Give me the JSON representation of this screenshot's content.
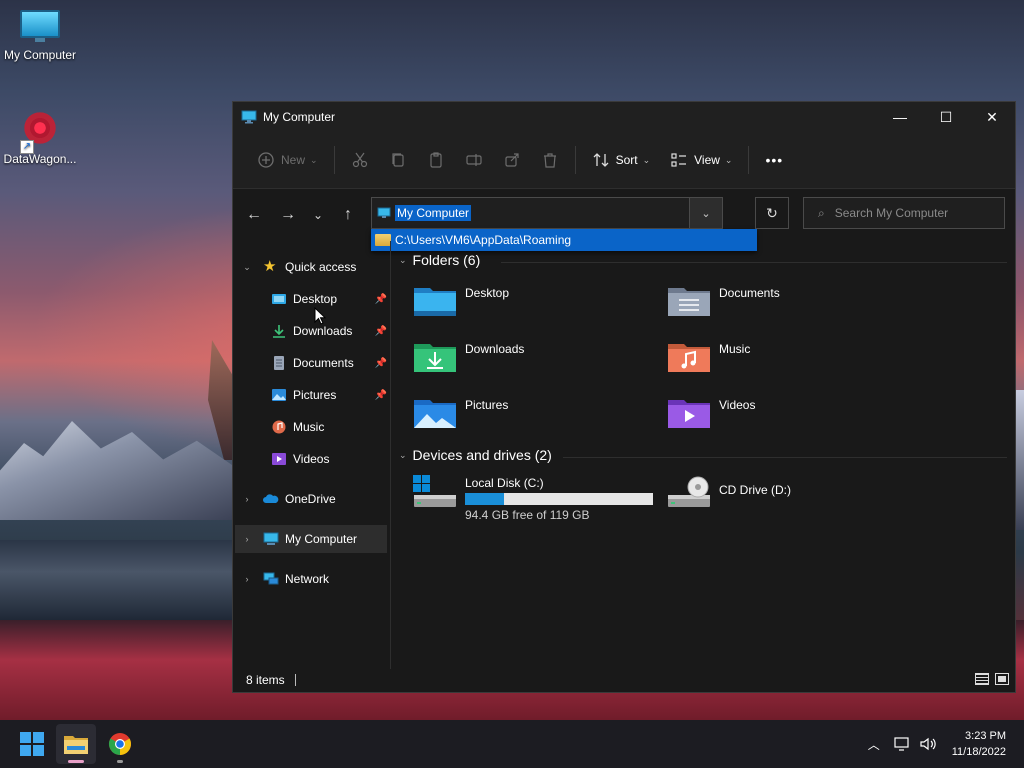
{
  "colors": {
    "accent": "#0a64c8",
    "window_bg": "#191919",
    "taskbar_bg": "#1c1c22"
  },
  "desktop": {
    "icons": [
      {
        "label": "My Computer",
        "icon": "monitor-icon"
      },
      {
        "label": "DataWagon...",
        "icon": "datawagon-icon"
      }
    ]
  },
  "window": {
    "title": "My Computer",
    "controls": {
      "minimize": "—",
      "maximize": "☐",
      "close": "✕"
    },
    "toolbar": {
      "new_label": "New",
      "sort_label": "Sort",
      "view_label": "View",
      "more_label": "•••"
    },
    "address": {
      "path": "My Computer",
      "suggestion": "C:\\Users\\VM6\\AppData\\Roaming"
    },
    "search": {
      "placeholder": "Search My Computer"
    },
    "sidebar": {
      "quick_access": "Quick access",
      "items": [
        {
          "label": "Desktop",
          "pinned": true
        },
        {
          "label": "Downloads",
          "pinned": true
        },
        {
          "label": "Documents",
          "pinned": true
        },
        {
          "label": "Pictures",
          "pinned": true
        },
        {
          "label": "Music",
          "pinned": false
        },
        {
          "label": "Videos",
          "pinned": false
        }
      ],
      "onedrive": "OneDrive",
      "this_pc": "My Computer",
      "network": "Network"
    },
    "content": {
      "folders_header": "Folders (6)",
      "folders": [
        "Desktop",
        "Documents",
        "Downloads",
        "Music",
        "Pictures",
        "Videos"
      ],
      "devices_header": "Devices and drives (2)",
      "drives": [
        {
          "name": "Local Disk (C:)",
          "free_text": "94.4 GB free of 119 GB",
          "used_fraction": 0.21
        },
        {
          "name": "CD Drive (D:)"
        }
      ]
    },
    "status": {
      "items_count": "8 items"
    }
  },
  "taskbar": {
    "time": "3:23 PM",
    "date": "11/18/2022"
  }
}
